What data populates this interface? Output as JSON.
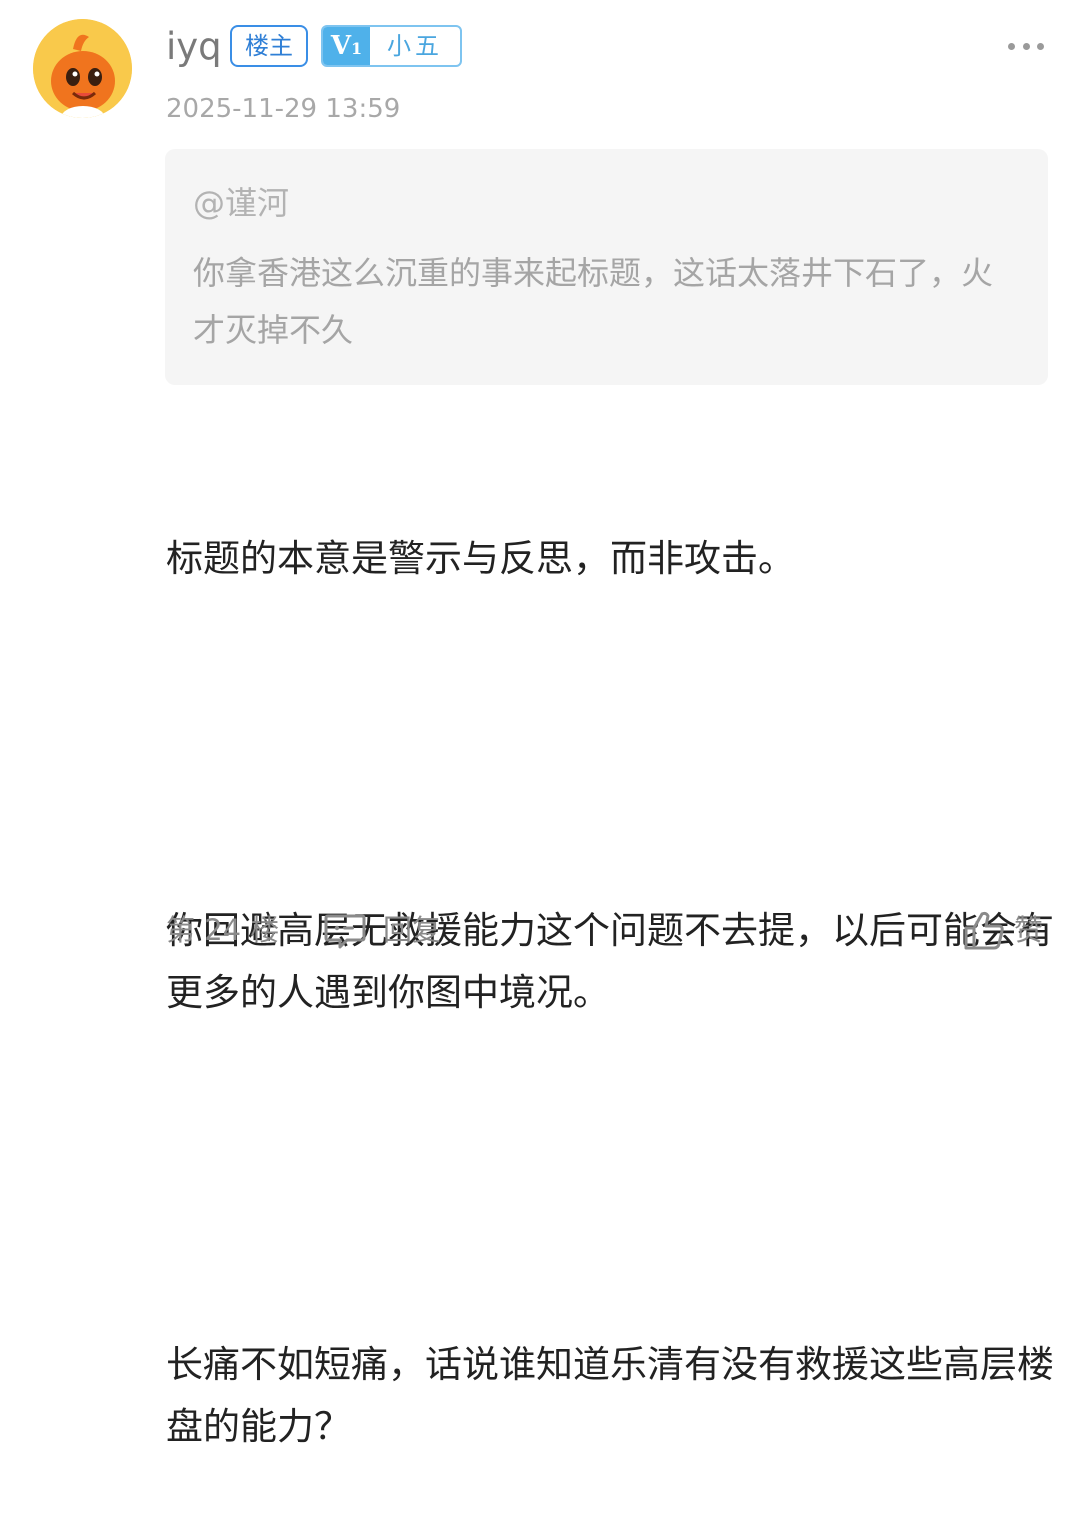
{
  "author": {
    "name": "iyq",
    "owner_badge": "楼主",
    "level_badge": {
      "level": "V",
      "level_num": "1",
      "title": "小五"
    },
    "avatar_icon": "orange-mascot-avatar",
    "post_time": "2025-11-29 13:59"
  },
  "quote": {
    "mention": "@谨河",
    "text": "你拿香港这么沉重的事来起标题，这话太落井下石了，火才灭掉不久"
  },
  "content": {
    "p1": "标题的本意是警示与反思，而非攻击。",
    "p2": "你回避高层无救援能力这个问题不去提，以后可能会有更多的人遇到你图中境况。",
    "p3": "长痛不如短痛，话说谁知道乐清有没有救援这些高层楼盘的能力？"
  },
  "footer": {
    "floor": "第 24 楼",
    "reply_label": "回复",
    "like_label": "赞"
  },
  "colors": {
    "owner_badge": "#2f7fd6",
    "level_badge": "#4fb1ea",
    "avatar_bg": "#f9c94b",
    "quote_bg": "#f5f5f5"
  }
}
